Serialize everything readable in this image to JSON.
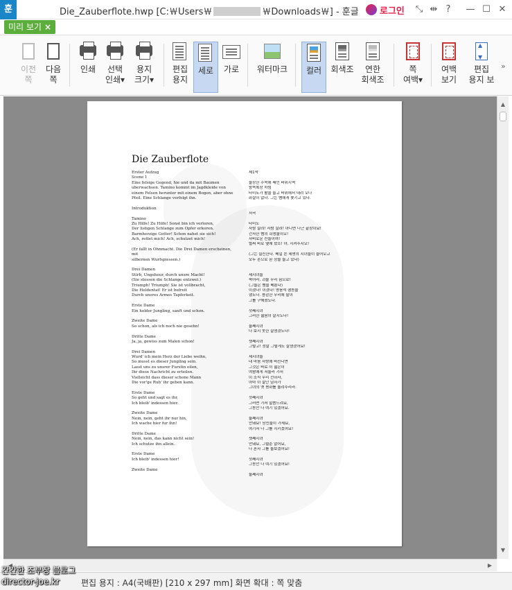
{
  "window": {
    "app_icon": "훈",
    "title_prefix": "Die_Zauberflote.hwp [C:￦Users￦",
    "title_suffix": "￦Downloads￦] - 훈글",
    "login_label": "로그인",
    "buttons": {
      "shrink": "⤡",
      "move": "⇹",
      "help": "?",
      "minimize": "—",
      "maximize": "☐",
      "close": "✕"
    }
  },
  "tab": {
    "label": "미리 보기",
    "close": "×"
  },
  "ribbon": {
    "prev_page": "이전\n쪽",
    "next_page": "다음\n쪽",
    "print": "인쇄",
    "select_print": "선택\n인쇄▾",
    "paper_size": "용지\n크기▾",
    "edit_paper": "편집\n용지",
    "portrait": "세로",
    "landscape": "가로",
    "watermark": "워터마크",
    "color": "컬러",
    "grayscale": "회색조",
    "light_gray": "연한\n회색조",
    "page_margin": "쪽\n여백▾",
    "margin_view": "여백\n보기",
    "edit_paper_view": "편집\n용지 보",
    "more": "»"
  },
  "document": {
    "title": "Die Zauberflote",
    "german": [
      "Erster Aufzug",
      "Scene 1",
      "Eine felsige Gegend, hie und da mit Baumen",
      "uberwachsen. Tamino kommt im Jagdkleide von",
      "einem Felsen herunter mit einem Bogen, aber ohne",
      "Pfeil. Eine Schlange verfolgt ihn.",
      "",
      "Introduktion",
      "",
      "Tamino",
      "  Zu Hilfe! Zu Hilfe! Sonst bin ich verloren,",
      "  Der listigen Schlange zum Opfer erkoren.",
      "  Barmherzige Gotter! Schon nahet sie sich!",
      "  Ach, rettet mich! Ach, schutzet mich!",
      "",
      "(Er fallt in Ohnmacht. Die Drei Damen erscheinen,",
      "mit",
      "silbernen Wurfspiessen.)",
      "",
      "Drei Damen",
      "  Stirb, Ungeheur, durch unsre Macht!",
      "(Sie stossen die Schlange entzwei.)",
      "  Triumph! Triumph! Sie ist vollbracht,",
      "  Die Heldentat! Er ist befreit",
      "  Durch unsres Armes Tapferkeit.",
      "",
      "Erste Dame",
      "  Ein holder Jungling, sanft und schon.",
      "",
      "Zweite Dame",
      "  So schon, als ich noch nie gesehn!",
      "",
      "Dritte Dame",
      "  Ja, ja, gewiss zum Malen schon!",
      "",
      "Drei Damen",
      "  Wurd' ich mein Herz der Liebe weihn,",
      "  So musst es dieser Jungling sein.",
      "  Lasst uns zu unsrer Furstin eilen,",
      "  Ihr diese Nachricht zu erteilen.",
      "  Vielleicht dass dieser schone Mann",
      "  Die vor'ge Ruh' ihr geben kann.",
      "",
      "Erste Dame",
      "  So geht und sagt es ihr,",
      "  Ich bleib' indessen hier.",
      "",
      "Zweite Dame",
      "  Nein, nein, geht ihr nur hin,",
      "  Ich wache hier fur ihn!",
      "",
      "Dritte Dame",
      "  Nein, nein, das kann nicht sein!",
      "  Ich schutze ihn allein.",
      "",
      "Erste Dame",
      "  Ich bleib' indessen hier!",
      "",
      "Zweite Dame"
    ],
    "korean": [
      "제1막",
      "",
      "울창한 수목에 쌔인 바위지역",
      "왕족복장 차림",
      "타미노가 활을 들고 바위에서 내려 오나",
      "화살이 없다. 그는 뱀에게 쫓기고 있다.",
      "",
      "",
      "서곡",
      "",
      "타미노",
      "사람 살려! 사람 살려! 아니면 나근 끝장이요!",
      "간사한 뱀의 희생물이오!",
      "자비로운 신들이여!",
      "벌써 바로 옆에 왔소! 아, 지켜주시오!",
      "",
      "(그는 실신한다. 베일 쓴 세명의 시녀들이 들어오고",
      "모두 손으로 된 창을 들고 있다)",
      "",
      "",
      "세시녀들",
      "죽어라, 괴물 우리 힘으로!",
      "(그들은 뱀을 베툰다)",
      "이겼다! 이겼다! 영웅적 행동을",
      "했도다. 용감한 우리에 팔이",
      "그를 구해졌도다.",
      "",
      "첫째시녀",
      "그러한 젊음이 잘지도다!",
      "",
      "둘째시녀",
      "나 보지 못한 잘생겼도다!",
      "",
      "셋째시녀",
      "그렇고! 정말 그렇게도 잘생겼어요!",
      "",
      "세시녀들",
      "내 마음 사랑에 바친다면",
      "그것은 바로 이 젊은이",
      "여왕에게 서둘러 가서",
      "이 소식 우리 전하자,",
      "아마 이 잘난 남자가",
      "그녀의 옛 평화를 돌려주리라.",
      "",
      "첫째시녀",
      "그러면 가서 말씀드려요,",
      "그동안 나 여기 있겠어요.",
      "",
      "둘째시녀",
      "안돼요! 당신들이 가세요,",
      "여기서 나 그를 지키겠어요!",
      "",
      "셋째시녀",
      "안돼요, 그럴순 없어요,",
      "나 혼자 그를 돌보겠어요!",
      "",
      "첫째시녀",
      "그동안 나 여기 있겠어요!",
      "",
      "둘째시녀"
    ]
  },
  "status": {
    "text": "편집 용지 : A4(국배판)  [210 x 297 mm]  화면 확대 : 쪽 맞춤",
    "blog_line1": "간간한 조부장 블로그",
    "blog_line2": "director-joe.kr"
  },
  "scroll": {
    "up": "▲",
    "down": "▼",
    "left": "◀",
    "right": "▶"
  },
  "colors": {
    "accent_green": "#5cae3c",
    "brand_blue": "#1a86c8",
    "login_red": "#e3224b",
    "active_blue": "#c7d9f2"
  }
}
